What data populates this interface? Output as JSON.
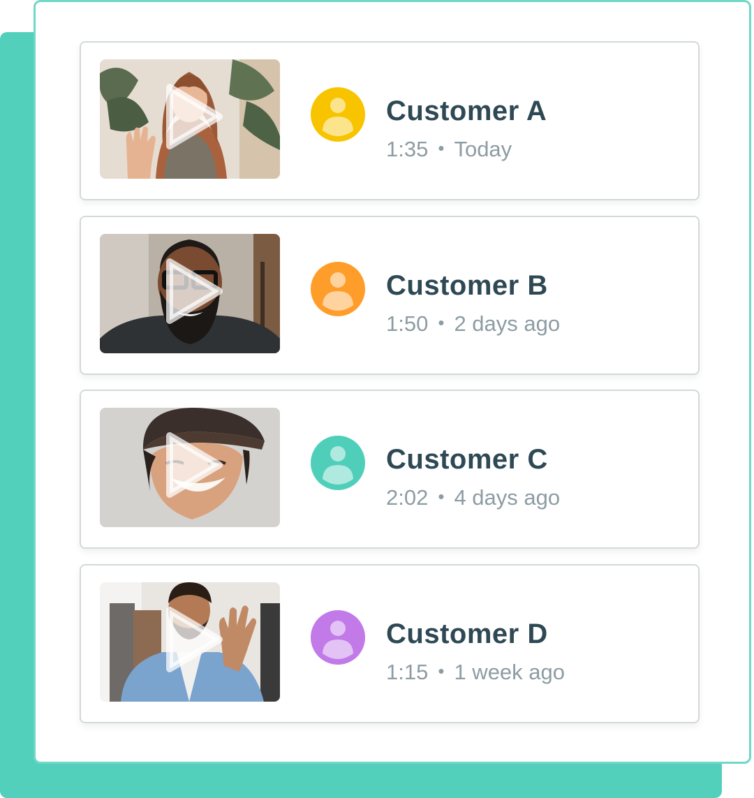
{
  "accent_color": "#52d0bb",
  "play_icon": "play-icon",
  "avatar_icon": "user-icon",
  "separator": "•",
  "customers": [
    {
      "name": "Customer A",
      "duration": "1:35",
      "date": "Today",
      "avatar_color": "#f8c400",
      "thumbnail": "woman waving with plant background"
    },
    {
      "name": "Customer B",
      "duration": "1:50",
      "date": "2 days ago",
      "avatar_color": "#ff9d2a",
      "thumbnail": "man with glasses and beard smiling"
    },
    {
      "name": "Customer C",
      "duration": "2:02",
      "date": "4 days ago",
      "avatar_color": "#4fcfb9",
      "thumbnail": "man in cap smiling"
    },
    {
      "name": "Customer D",
      "duration": "1:15",
      "date": "1 week ago",
      "avatar_color": "#c17ae8",
      "thumbnail": "man in denim shirt waving"
    }
  ]
}
